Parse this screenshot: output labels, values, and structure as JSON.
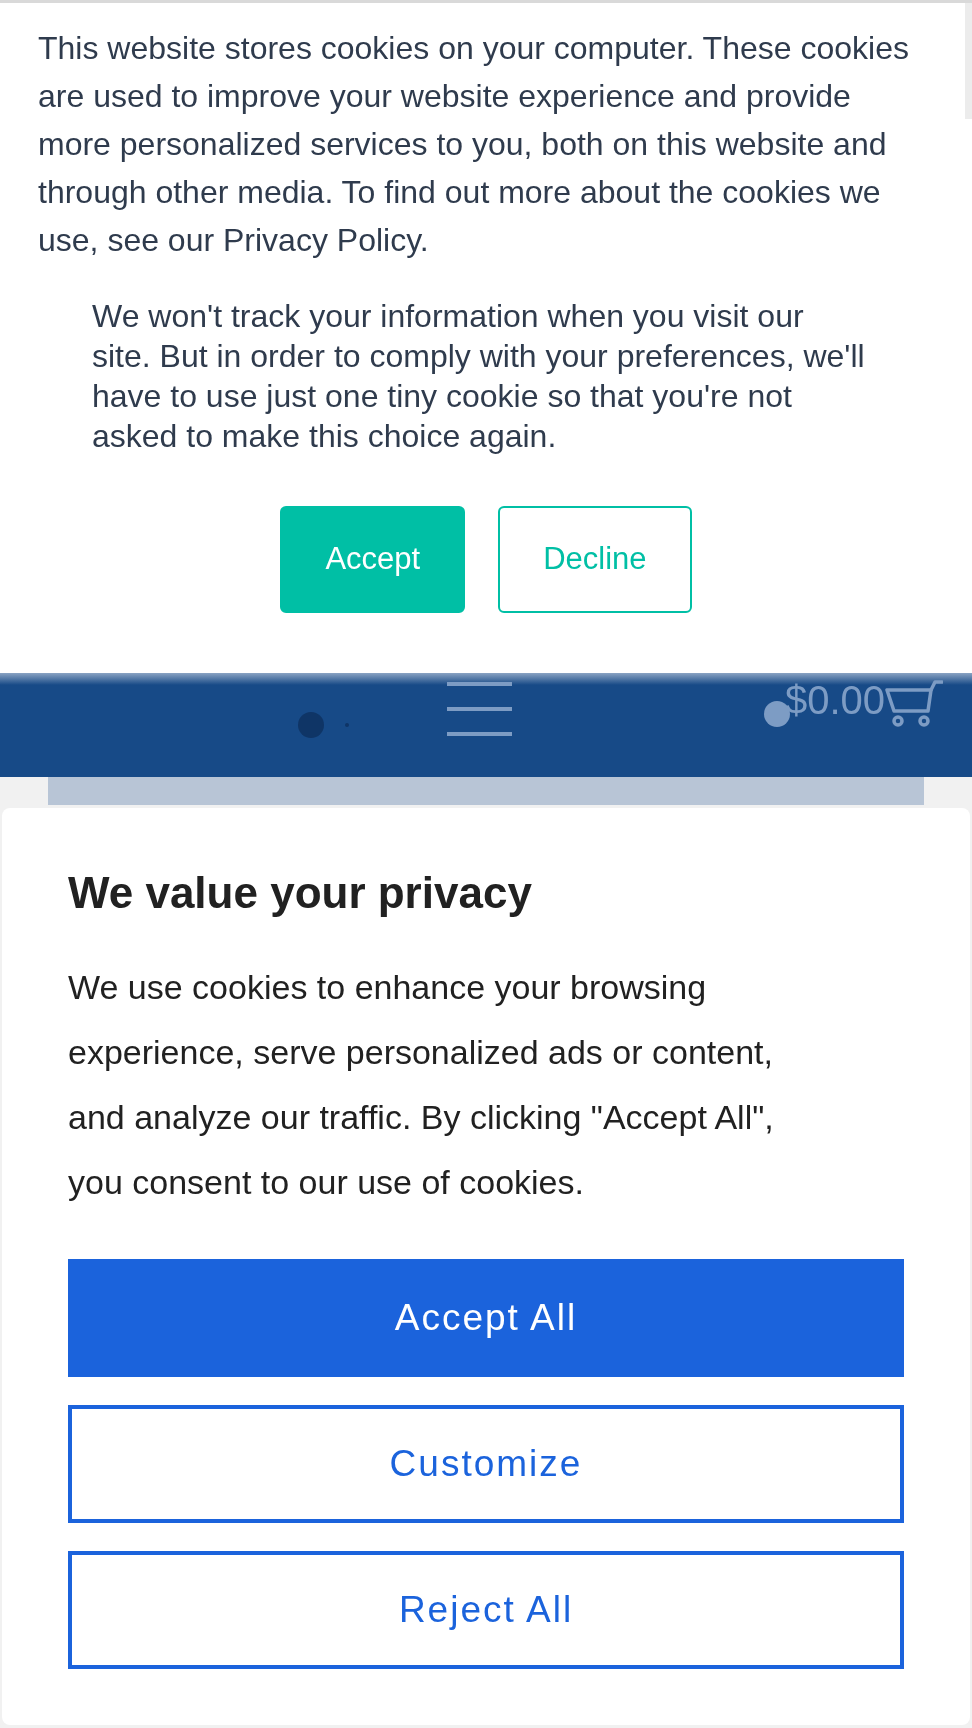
{
  "cookie_banner": {
    "message": "This website stores cookies on your computer. These cookies are used to improve your website experience and provide more personalized services to you, both on this website and through other media. To find out more about the cookies we use, see our Privacy Policy.",
    "note": "We won't track your information when you visit our site. But in order to comply with your preferences, we'll have to use just one tiny cookie so that you're not asked to make this choice again.",
    "buttons": [
      {
        "label": "Accept",
        "kind": "filled"
      },
      {
        "label": "Decline",
        "kind": "outline"
      }
    ]
  },
  "header": {
    "cart_total": "$0.00"
  },
  "privacy_dialog": {
    "title": "We value your privacy",
    "body": "We use cookies to enhance your browsing experience, serve personalized ads or content, and analyze our traffic. By clicking \"Accept All\", you consent to our use of cookies.",
    "buttons": [
      {
        "label": "Accept All",
        "kind": "filled"
      },
      {
        "label": "Customize",
        "kind": "outline"
      },
      {
        "label": "Reject All",
        "kind": "outline"
      }
    ]
  }
}
